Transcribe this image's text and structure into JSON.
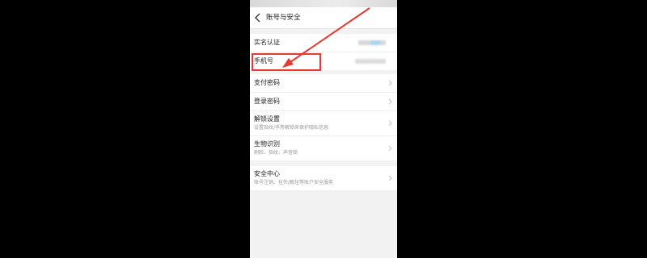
{
  "nav": {
    "title": "账号与安全"
  },
  "groups": [
    {
      "items": [
        {
          "label": "实名认证",
          "value_hidden": true
        },
        {
          "label": "手机号",
          "value_hidden": true,
          "highlighted": true
        }
      ]
    },
    {
      "items": [
        {
          "label": "支付密码"
        },
        {
          "label": "登录密码"
        },
        {
          "label": "解锁设置",
          "sub": "设置指纹/手势解锁来保护隐私信息"
        },
        {
          "label": "生物识别",
          "sub": "刷脸、指纹、声音锁"
        }
      ]
    },
    {
      "items": [
        {
          "label": "安全中心",
          "sub": "账号注销、挂失/解挂等账户安全服务"
        }
      ]
    }
  ],
  "colors": {
    "annotation": "#e53935",
    "page_background": "#f2f2f2",
    "letterbox": "#000000"
  },
  "icons": [
    "back-icon",
    "chevron-right-icon"
  ]
}
